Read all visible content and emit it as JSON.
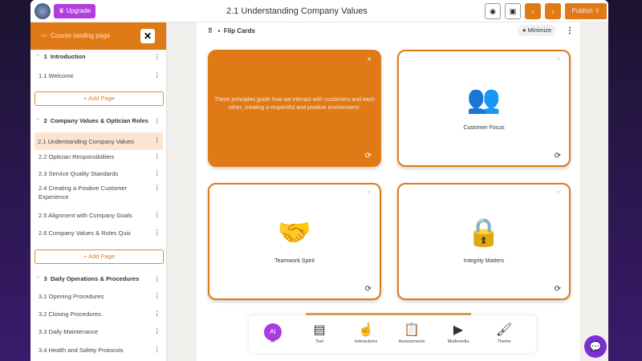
{
  "header": {
    "upgrade": "Upgrade",
    "title": "2.1 Understanding Company Values",
    "preview_icon": "eye-icon",
    "save_icon": "save-icon",
    "prev": "‹",
    "next": "›",
    "publish": "Publish"
  },
  "sidebar": {
    "back": "Course landing page",
    "add_page": "+ Add Page",
    "sections": [
      {
        "num": "1",
        "title": "Introduction",
        "pages": [
          "1.1 Welcome"
        ]
      },
      {
        "num": "2",
        "title": "Company Values & Optician Roles",
        "pages": [
          "2.1 Understanding Company Values",
          "2.2 Optician Responsibilities",
          "2.3 Service Quality Standards",
          "2.4 Creating a Positive Customer Experience",
          "2.5 Alignment with Company Goals",
          "2.6 Company Values & Roles Quiz"
        ]
      },
      {
        "num": "3",
        "title": "Daily Operations & Procedures",
        "pages": [
          "3.1 Opening Procedures",
          "3.2 Closing Procedures",
          "3.3 Daily Maintenance",
          "3.4 Health and Safety Protocols"
        ]
      }
    ]
  },
  "block": {
    "title": "Flip Cards",
    "minimize": "Minimize"
  },
  "cards": [
    {
      "text": "These principles guide how we interact with customers and each other, creating a respectful and positive environment.",
      "flipped": true
    },
    {
      "text": "Customer Focus",
      "icon": "people-icon"
    },
    {
      "text": "Teamwork Spirit",
      "icon": "handshake-icon"
    },
    {
      "text": "Integrity Matters",
      "icon": "lock-icon"
    }
  ],
  "toolbar": {
    "ai_badge": "AI",
    "items": [
      "AI",
      "Text",
      "Interactions",
      "Assessments",
      "Multimedia",
      "Theme"
    ]
  }
}
